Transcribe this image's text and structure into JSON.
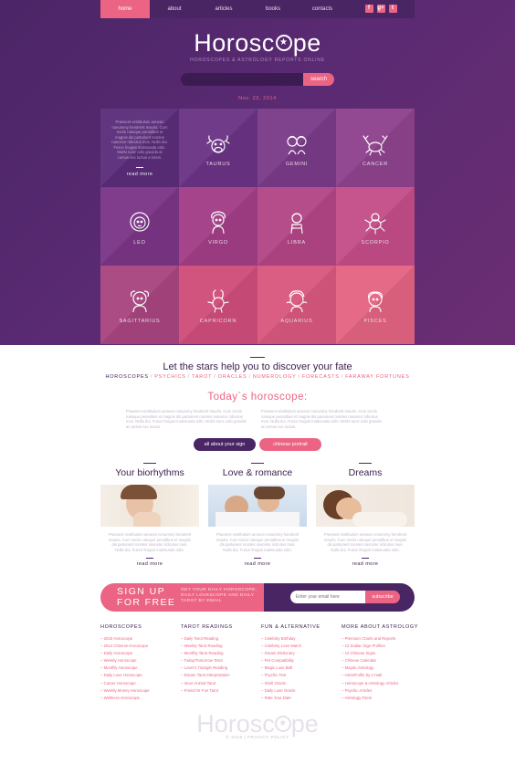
{
  "nav": {
    "items": [
      {
        "label": "home",
        "active": true
      },
      {
        "label": "about"
      },
      {
        "label": "articles"
      },
      {
        "label": "books"
      },
      {
        "label": "contacts"
      }
    ],
    "social": [
      "f",
      "g+",
      "t"
    ]
  },
  "hero": {
    "logo_text_a": "Horosc",
    "logo_text_b": "pe",
    "tagline": "HOROSCOPES & ASTROLOGY REPORTS ONLINE",
    "search_placeholder": "",
    "search_button": "search",
    "date": "Nov. 22, 2014"
  },
  "intro_card": {
    "text": "Praesent vestibulum aenean nonummy hendrerit mauris. Cum sociis natoque penatibus et magnis dis parturient montes nascetur ridiculus mus. Nulla dui. Fusce feugiat malesuada odio. Morbi nunc odio gravida at cursus nec luctus a lorem.",
    "more": "read more"
  },
  "signs": [
    {
      "label": "TAURUS",
      "color": "#6a3384"
    },
    {
      "label": "GEMINI",
      "color": "#7a3a88"
    },
    {
      "label": "CANCER",
      "color": "#8e428d"
    },
    {
      "label": "LEO",
      "color": "#7a3586"
    },
    {
      "label": "VIRGO",
      "color": "#a23d86"
    },
    {
      "label": "LIBRA",
      "color": "#b34686"
    },
    {
      "label": "SCORPIO",
      "color": "#c44d88"
    },
    {
      "label": "SAGITTARIUS",
      "color": "#a8457f"
    },
    {
      "label": "CAPRICORN",
      "color": "#cf4d7a"
    },
    {
      "label": "AQUARIUS",
      "color": "#d8577e"
    },
    {
      "label": "PISCES",
      "color": "#e46482"
    }
  ],
  "intro_section": {
    "title": "Let the stars help you to discover your fate",
    "tags": [
      "HOROSCOPES",
      "PSYCHICS",
      "TAROT",
      "ORACLES",
      "NUMEROLOGY",
      "FORECASTS",
      "FARAWAY FORTUNES"
    ]
  },
  "today": {
    "title": "Today`s horoscope:",
    "text_left": "Praesent vestibulum aenean nonummy hendrerit mauris. Cum sociis natoque penatibus et magnis dis parturient montes nascetur ridiculus mus. Nulla dui. Fusce feugiat malesuada odio. Morbi nunc odio gravida at cursus nec luctus.",
    "text_right": "Praesent vestibulum aenean nonummy hendrerit mauris. Cum sociis natoque penatibus et magnis dis parturient montes nascetur ridiculus mus. Nulla dui. Fusce feugiat malesuada odio. Morbi nunc odio gravida at cursus nec luctus.",
    "btn_about": "all about your sign",
    "btn_chinese": "chinese portrait"
  },
  "columns": [
    {
      "title": "Your biorhythms",
      "text": "Praesent vestibulum aenean nonummy hendrerit mauris. Cum sociis natoque penatibus et magnis dis parturient montes nascetur ridiculus mus. Nulla dui. Fusce feugiat malesuada odio.",
      "more": "read more"
    },
    {
      "title": "Love & romance",
      "text": "Praesent vestibulum aenean nonummy hendrerit mauris. Cum sociis natoque penatibus et magnis dis parturient montes nascetur ridiculus mus. Nulla dui. Fusce feugiat malesuada odio.",
      "more": "read more"
    },
    {
      "title": "Dreams",
      "text": "Praesent vestibulum aenean nonummy hendrerit mauris. Cum sociis natoque penatibus et magnis dis parturient montes nascetur ridiculus mus. Nulla dui. Fusce feugiat malesuada odio.",
      "more": "read more"
    }
  ],
  "signup": {
    "title_1": "SIGN UP",
    "title_2": "FOR FREE",
    "desc": "GET YOUR DAILY HOROSCOPE, DAILY LOVESCOPE AND DAILY TAROT BY EMAIL",
    "email_placeholder": "Enter your email here",
    "subscribe": "subscribe"
  },
  "footer": {
    "columns": [
      {
        "heading": "HOROSCOPES",
        "items": [
          "2015 Horoscope",
          "2014 Chinese Horoscope",
          "Daily Horoscope",
          "Weekly Horoscope",
          "Monthly Horoscope",
          "Daily Love Horoscope",
          "Career Horoscope",
          "Weekly Money Horoscope",
          "Wellness Horoscope"
        ]
      },
      {
        "heading": "TAROT READINGS",
        "items": [
          "Daily Tarot Reading",
          "Weekly Tarot Reading",
          "Monthly Tarot Reading",
          "Today/Tomorrow Tarot",
          "Lover's Triangle Reading",
          "Dream Tarot Interpretation",
          "Inner Animal Tarot",
          "Friend Or Foe Tarot"
        ]
      },
      {
        "heading": "FUN & ALTERNATIVE",
        "items": [
          "Celebrity Birthday",
          "Celebrity Love Match",
          "Dream Dictionary",
          "Pet Compatibility",
          "Magic Love Ball",
          "Psychic Test",
          "Shell Oracle",
          "Daily Love Oracle",
          "Rate Your Date"
        ]
      },
      {
        "heading": "MORE ABOUT ASTROLOGY",
        "items": [
          "Premium Charts and Reports",
          "12 Zodiac Sign Profiles",
          "12 Chinese Signs",
          "Chinese Calendar",
          "Mayan Astrology",
          "AstroProfile by e-mail",
          "Horoscope & Astrology Articles",
          "Psychic Articles",
          "Astrology Facts"
        ]
      }
    ],
    "logo_text_a": "Horosc",
    "logo_text_b": "pe",
    "copyright": "© 2015 | PRIVACY POLICY"
  }
}
